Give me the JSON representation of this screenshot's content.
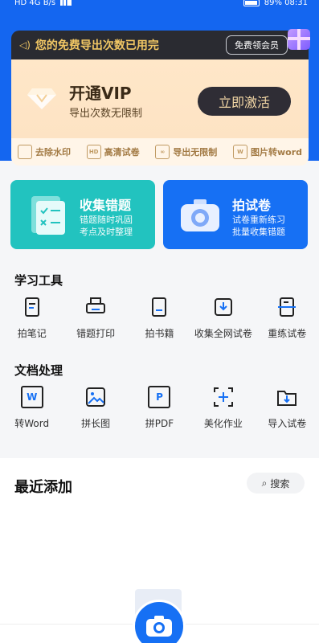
{
  "status_bar": {
    "left": "HD  4G  B/s",
    "right": "89%  08:31"
  },
  "notice": {
    "message": "您的免费导出次数已用完",
    "button": "免费领会员"
  },
  "vip": {
    "title": "开通VIP",
    "subtitle": "导出次数无限制",
    "button": "立即激活"
  },
  "features": [
    {
      "icon": "person-doc-icon",
      "label": "去除水印",
      "glyph": ""
    },
    {
      "icon": "hd-icon",
      "label": "高清试卷",
      "glyph": "HD"
    },
    {
      "icon": "infinity-icon",
      "label": "导出无限制",
      "glyph": "∞"
    },
    {
      "icon": "word-icon",
      "label": "图片转word",
      "glyph": "W"
    }
  ],
  "cards": [
    {
      "title": "收集错题",
      "desc1": "错题随时巩固",
      "desc2": "考点及时整理"
    },
    {
      "title": "拍试卷",
      "desc1": "试卷重新练习",
      "desc2": "批量收集错题"
    }
  ],
  "sections": {
    "study_tools": "学习工具",
    "doc_tools": "文档处理"
  },
  "study_tools": [
    {
      "label": "拍笔记",
      "icon": "notebook-icon"
    },
    {
      "label": "错题打印",
      "icon": "printer-icon"
    },
    {
      "label": "拍书籍",
      "icon": "book-icon"
    },
    {
      "label": "收集全网试卷",
      "icon": "download-tray-icon"
    },
    {
      "label": "重练试卷",
      "icon": "scan-doc-icon"
    }
  ],
  "doc_tools": [
    {
      "label": "转Word",
      "icon": "word-doc-icon",
      "glyph": "W"
    },
    {
      "label": "拼长图",
      "icon": "image-icon",
      "glyph": ""
    },
    {
      "label": "拼PDF",
      "icon": "pdf-icon",
      "glyph": "P"
    },
    {
      "label": "美化作业",
      "icon": "beautify-icon",
      "glyph": ""
    },
    {
      "label": "导入试卷",
      "icon": "import-folder-icon",
      "glyph": ""
    }
  ],
  "recent": {
    "title": "最近添加",
    "search_label": "搜索"
  },
  "colors": {
    "primary": "#1466f0",
    "green_card": "#22c3bf",
    "blue_card": "#1670f4",
    "gold": "#f1c764"
  }
}
